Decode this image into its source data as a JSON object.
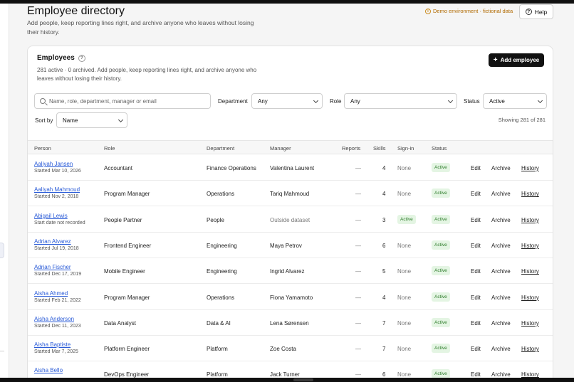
{
  "header": {
    "title": "Employee directory",
    "subtitle": "Add people, keep reporting lines right, and archive anyone who leaves without losing their history.",
    "demo_badge": "Demo environment · fictional data",
    "help_label": "Help"
  },
  "card": {
    "title": "Employees",
    "description": "281 active · 0 archived. Add people, keep reporting lines right, and archive anyone who leaves without losing their history.",
    "add_label": "Add employee"
  },
  "filters": {
    "search_placeholder": "Name, role, department, manager or email",
    "department_label": "Department",
    "department_value": "Any",
    "role_label": "Role",
    "role_value": "Any",
    "status_label": "Status",
    "status_value": "Active",
    "sort_label": "Sort by",
    "sort_value": "Name",
    "showing": "Showing 281 of 281"
  },
  "table": {
    "columns": [
      "Person",
      "Role",
      "Department",
      "Manager",
      "Reports",
      "Skills",
      "Sign-in",
      "Status"
    ],
    "actions": {
      "edit": "Edit",
      "archive": "Archive",
      "history": "History"
    },
    "rows": [
      {
        "name": "Aaliyah Jansen",
        "started": "Started Mar 10, 2026",
        "role": "Accountant",
        "department": "Finance Operations",
        "manager": "Valentina Laurent",
        "reports": "—",
        "skills": "4",
        "signin": "None",
        "status": "Active"
      },
      {
        "name": "Aaliyah Mahmoud",
        "started": "Started Nov 2, 2018",
        "role": "Program Manager",
        "department": "Operations",
        "manager": "Tariq Mahmoud",
        "reports": "—",
        "skills": "4",
        "signin": "None",
        "status": "Active"
      },
      {
        "name": "Abigail Lewis",
        "started": "Start date not recorded",
        "role": "People Partner",
        "department": "People",
        "manager": "Outside dataset",
        "reports": "—",
        "skills": "3",
        "signin": "Active",
        "status": "Active"
      },
      {
        "name": "Adrian Alvarez",
        "started": "Started Jul 19, 2018",
        "role": "Frontend Engineer",
        "department": "Engineering",
        "manager": "Maya Petrov",
        "reports": "—",
        "skills": "6",
        "signin": "None",
        "status": "Active"
      },
      {
        "name": "Adrian Fischer",
        "started": "Started Dec 17, 2019",
        "role": "Mobile Engineer",
        "department": "Engineering",
        "manager": "Ingrid Alvarez",
        "reports": "—",
        "skills": "5",
        "signin": "None",
        "status": "Active"
      },
      {
        "name": "Aisha Ahmed",
        "started": "Started Feb 21, 2022",
        "role": "Program Manager",
        "department": "Operations",
        "manager": "Fiona Yamamoto",
        "reports": "—",
        "skills": "4",
        "signin": "None",
        "status": "Active"
      },
      {
        "name": "Aisha Anderson",
        "started": "Started Dec 11, 2023",
        "role": "Data Analyst",
        "department": "Data & AI",
        "manager": "Lena Sørensen",
        "reports": "—",
        "skills": "7",
        "signin": "None",
        "status": "Active"
      },
      {
        "name": "Aisha Baptiste",
        "started": "Started Mar 7, 2025",
        "role": "Platform Engineer",
        "department": "Platform",
        "manager": "Zoe Costa",
        "reports": "—",
        "skills": "7",
        "signin": "None",
        "status": "Active"
      },
      {
        "name": "Aisha Bello",
        "started": "",
        "role": "DevOps Engineer",
        "department": "Platform",
        "manager": "Jack Turner",
        "reports": "—",
        "skills": "6",
        "signin": "None",
        "status": "Active"
      }
    ]
  }
}
